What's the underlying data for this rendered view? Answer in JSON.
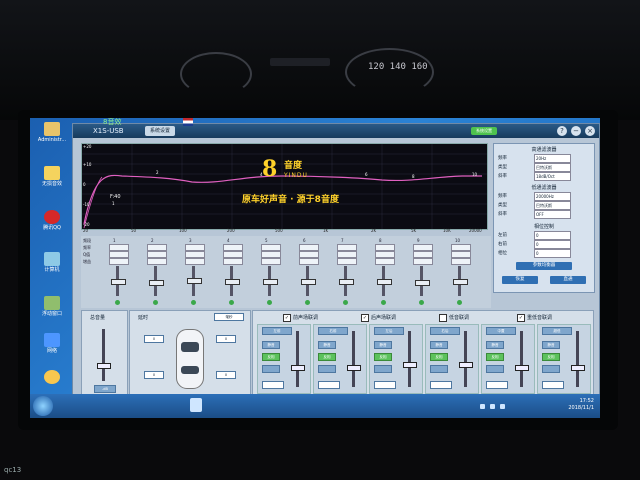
{
  "dashboard": {
    "gauge_text": "120 140 160"
  },
  "desktop": {
    "icons": [
      {
        "label": "Administr...",
        "color": "#e9c46a"
      },
      {
        "label": "无损音效",
        "color": "#f4d35e"
      },
      {
        "label": "腾讯QQ",
        "color": "#d62828"
      },
      {
        "label": "计算机",
        "color": "#8ecae6"
      },
      {
        "label": "浮动窗口",
        "color": "#90be6d"
      },
      {
        "label": "网络",
        "color": "#4d96ff"
      },
      {
        "label": "",
        "color": "#f9c74f"
      }
    ]
  },
  "app": {
    "title": "X1S-USB",
    "top_tag": "8音效",
    "tab": "系统设置",
    "green_button": "系统设置",
    "window_controls": [
      "?",
      "−",
      "×"
    ]
  },
  "graph": {
    "y_labels": [
      "+20",
      "+15",
      "+10",
      "+5",
      "0",
      "-5",
      "-10",
      "-15",
      "-20"
    ],
    "x_labels": [
      "20",
      "50",
      "100",
      "200",
      "500",
      "1K",
      "2K",
      "5K",
      "10K",
      "20000"
    ],
    "f_label": "F:40",
    "point_numbers": [
      "1",
      "2",
      "3",
      "4",
      "5",
      "6",
      "7",
      "8",
      "9",
      "10"
    ],
    "brand_digit": "8",
    "brand_cn": "音度",
    "brand_en": "YINDU",
    "slogan": "原车好声音 · 源于8音度"
  },
  "right_panel": {
    "title": "高通滤波器",
    "rows": [
      {
        "label": "频率",
        "value": "20Hz"
      },
      {
        "label": "类型",
        "value": "巴特沃斯"
      },
      {
        "label": "斜率",
        "value": "18dB/Oct"
      }
    ],
    "sub_title": "低通滤波器",
    "rows2": [
      {
        "label": "频率",
        "value": "20000Hz"
      },
      {
        "label": "类型",
        "value": "巴特沃斯"
      },
      {
        "label": "斜率",
        "value": "OFF"
      }
    ],
    "sub_title3": "相位控制",
    "rows3": [
      {
        "label": "左前",
        "value": "0"
      },
      {
        "label": "右前",
        "value": "0"
      },
      {
        "label": "相位",
        "value": "0"
      }
    ],
    "btn_main": "参数均衡器",
    "btn_a": "恢复",
    "btn_b": "直通"
  },
  "eq": {
    "row_labels": [
      "频段",
      "频率",
      "Q值",
      "增益"
    ],
    "channels": [
      "1",
      "2",
      "3",
      "4",
      "5",
      "6",
      "7",
      "8",
      "9",
      "10"
    ],
    "knob_levels": [
      0.5,
      0.45,
      0.55,
      0.5,
      0.5,
      0.5,
      0.5,
      0.5,
      0.45,
      0.5
    ]
  },
  "volume": {
    "title": "总音量",
    "value": "-dB",
    "level": 0.3
  },
  "delay": {
    "title": "延时",
    "unit_select": "毫秒",
    "labels": [
      "0",
      "0",
      "0",
      "0"
    ]
  },
  "channel_strip": {
    "checks": [
      {
        "label": "前声场联调",
        "checked": true
      },
      {
        "label": "后声场联调",
        "checked": true
      },
      {
        "label": "低音联调",
        "checked": false
      },
      {
        "label": "重低音联调",
        "checked": true
      }
    ],
    "channels": [
      {
        "name": "左前",
        "level": 0.35
      },
      {
        "name": "右前",
        "level": 0.35
      },
      {
        "name": "左后",
        "level": 0.4
      },
      {
        "name": "右后",
        "level": 0.4
      },
      {
        "name": "中置",
        "level": 0.35
      },
      {
        "name": "超低",
        "level": 0.35
      }
    ],
    "mute": "静音",
    "invert": "反相"
  },
  "taskbar": {
    "time": "17:52",
    "date": "2018/11/1"
  },
  "watermark": "qc13"
}
